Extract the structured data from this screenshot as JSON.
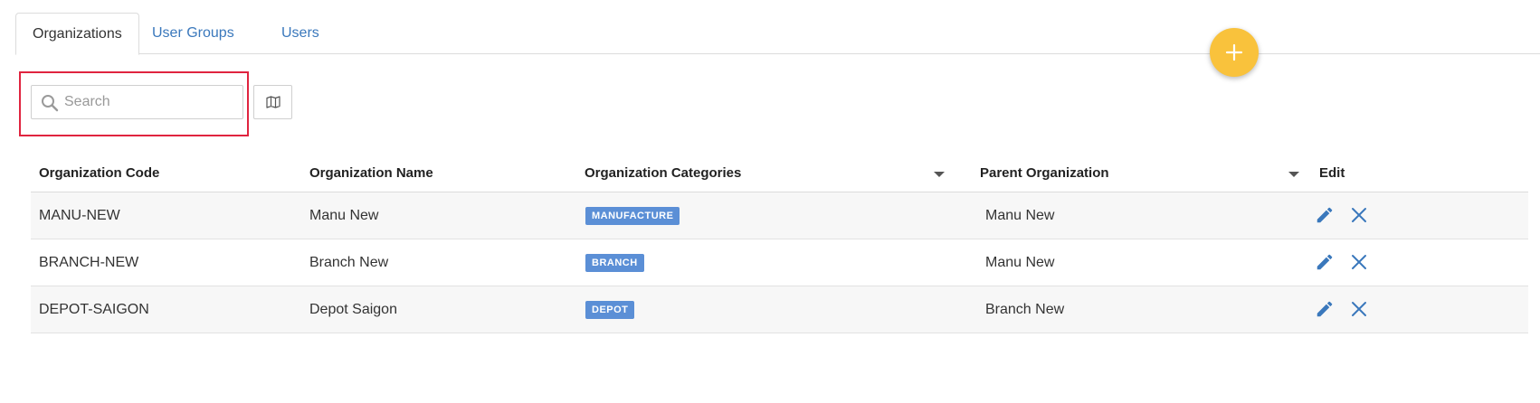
{
  "tabs": [
    {
      "label": "Organizations",
      "active": true
    },
    {
      "label": "User Groups",
      "active": false
    },
    {
      "label": "Users",
      "active": false
    }
  ],
  "search": {
    "placeholder": "Search",
    "value": ""
  },
  "table": {
    "columns": [
      "Organization Code",
      "Organization Name",
      "Organization Categories",
      "Parent Organization",
      "Edit"
    ],
    "rows": [
      {
        "code": "MANU-NEW",
        "name": "Manu New",
        "category": "MANUFACTURE",
        "parent": "Manu New"
      },
      {
        "code": "BRANCH-NEW",
        "name": "Branch New",
        "category": "BRANCH",
        "parent": "Manu New"
      },
      {
        "code": "DEPOT-SAIGON",
        "name": "Depot Saigon",
        "category": "DEPOT",
        "parent": "Branch New"
      }
    ]
  },
  "icons": {
    "add": "plus-icon",
    "search": "search-icon",
    "map": "map-icon",
    "edit": "pencil-icon",
    "delete": "close-icon",
    "sort": "caret-down-icon"
  },
  "colors": {
    "accent": "#3a78bc",
    "fab": "#f9c23c",
    "badge": "#5b8fd6",
    "highlight": "#e0243f",
    "action_icon": "#3a78bc"
  }
}
